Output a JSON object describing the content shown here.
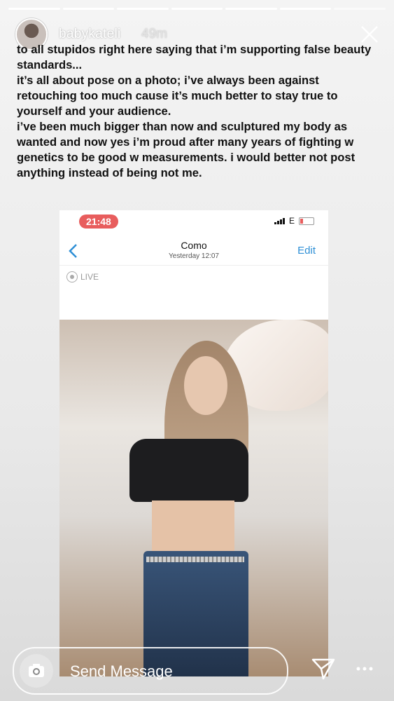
{
  "story": {
    "username": "babykateli",
    "posted_ago": "49m",
    "progress_segments_total": 7,
    "progress_segments_done": 6,
    "caption_lines": [
      "to all stupidos right here saying that i’m supporting false beauty standards...",
      "it’s all about pose on a photo; i’ve always been against retouching too much cause it’s much better to stay true to yourself and your audience.",
      "i’ve been much bigger than now and sculptured my body as wanted and now yes i’m proud after many years of fighting w genetics to be good w measurements. i would better not post anything instead of being not me."
    ]
  },
  "screenshot": {
    "status_time": "21:48",
    "network": "E",
    "album_title": "Como",
    "album_subtitle": "Yesterday  12:07",
    "edit_label": "Edit",
    "live_label": "LIVE"
  },
  "reply": {
    "placeholder": "Send Message"
  },
  "icons": {
    "close": "close-icon",
    "camera": "camera-icon",
    "send": "send-icon",
    "more": "more-icon",
    "back": "chevron-left-icon",
    "live": "live-photo-icon"
  },
  "colors": {
    "status_pill": "#e85d5d",
    "link_blue": "#2e8fd6"
  }
}
